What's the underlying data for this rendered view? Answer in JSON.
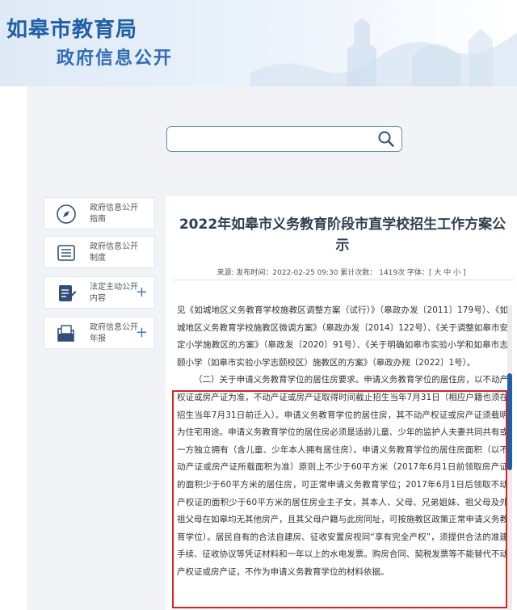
{
  "header": {
    "site_name": "如皋市教育局",
    "site_sub": "政府信息公开"
  },
  "search": {
    "placeholder": "",
    "icon": "search-icon"
  },
  "sidebar": {
    "items": [
      {
        "label": "政府信息公开指南",
        "icon": "compass-icon",
        "expand": ""
      },
      {
        "label": "政府信息公开制度",
        "icon": "list-icon",
        "expand": ""
      },
      {
        "label": "法定主动公开内容",
        "icon": "document-edit-icon",
        "expand": "+"
      },
      {
        "label": "政府信息公开年报",
        "icon": "folder-icon",
        "expand": "+"
      }
    ]
  },
  "article": {
    "title": "2022年如皋市义务教育阶段市直学校招生工作方案公示",
    "meta": "来源:  发布时间：2022-02-25 09:30  累计次数： 1419次  字体：[ 大 中 小 ]",
    "para1": "见《如城地区义务教育学校施教区调整方案（试行）》（皋政办发〔2011〕179号）、《如城地区义务教育学校施教区微调方案》（皋政办发〔2014〕122号）、《关于调整如皋市安定小学施教区的方案》（皋政发〔2020〕91号）、《关于明确如皋市实验小学和如皋市志颐小学（如皋市实验小学志颐校区）施教区的方案》（皋政办规〔2022〕1号）。",
    "para2": "（二）关于申请义务教育学位的居住房要求。申请义务教育学位的居住房，以不动产权证或房产证为准，不动产证或房产证取得时间截止招生当年7月31日（相应户籍也须在招生当年7月31日前迁入）。申请义务教育学位的居住房，其不动产权证或房产证须载明为住宅用途。申请义务教育学位的居住房必须是适龄儿童、少年的监护人夫妻共同共有或一方独立拥有（含儿童、少年本人拥有居住房）。申请义务教育学位的居住房面积（以不动产证或房产证所载面积为准）原则上不少于60平方米（2017年6月1日前领取房产证的面积少于60平方米的居住房，可正常申请义务教育学位；2017年6月1日后领取不动产权证的面积少于60平方米的居住房业主子女，其本人、父母、兄弟姐妹、祖父母及外祖父母在如皋均无其他房产，且其父母户籍与此房同址，可按施教区政策正常申请义务教育学位）。居民自有的合法自建房、征收安置房视同“享有完全产权”，须提供合法的准建手续、征收协议等凭证材料和一年以上的水电发票。购房合同、契税发票等不能替代不动产权证或房产证，不作为申请义务教育学位的材料依据。"
  },
  "colors": {
    "brand": "#1f5fa8",
    "highlight": "#e02020",
    "scroll": "#1f5fb0"
  }
}
